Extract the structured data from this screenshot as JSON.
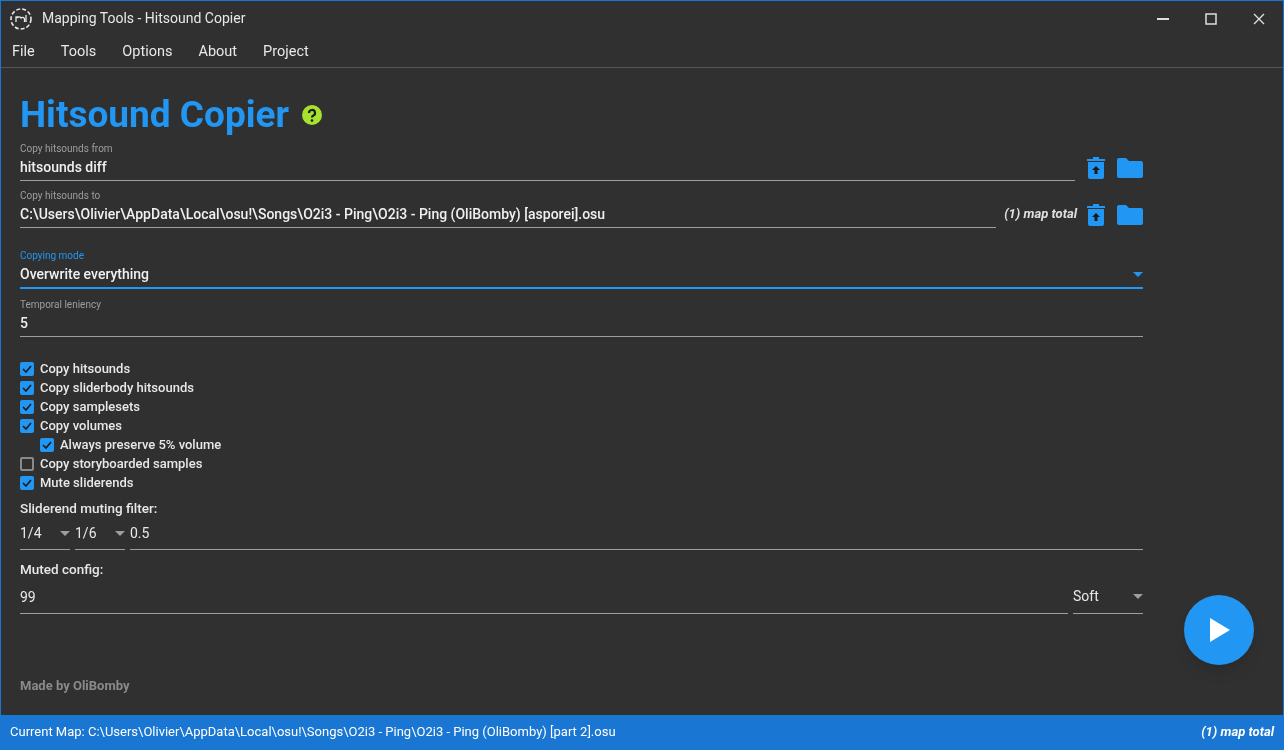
{
  "window": {
    "title": "Mapping Tools - Hitsound Copier"
  },
  "menu": [
    "File",
    "Tools",
    "Options",
    "About",
    "Project"
  ],
  "heading": "Hitsound Copier",
  "source": {
    "label": "Copy hitsounds from",
    "value": "hitsounds diff"
  },
  "target": {
    "label": "Copy hitsounds to",
    "value": "C:\\Users\\Olivier\\AppData\\Local\\osu!\\Songs\\O2i3 - Ping\\O2i3 - Ping (OliBomby) [asporei].osu",
    "note": "(1) map total"
  },
  "copying_mode": {
    "label": "Copying mode",
    "value": "Overwrite everything",
    "focused": true
  },
  "temporal_leniency": {
    "label": "Temporal leniency",
    "value": "5"
  },
  "options": [
    {
      "label": "Copy hitsounds",
      "checked": true
    },
    {
      "label": "Copy sliderbody hitsounds",
      "checked": true
    },
    {
      "label": "Copy samplesets",
      "checked": true
    },
    {
      "label": "Copy volumes",
      "checked": true,
      "children": [
        {
          "label": "Always preserve 5% volume",
          "checked": true
        }
      ]
    },
    {
      "label": "Copy storyboarded samples",
      "checked": false
    },
    {
      "label": "Mute sliderends",
      "checked": true
    }
  ],
  "sliderend_filter": {
    "label": "Sliderend muting filter:",
    "selects": [
      "1/4",
      "1/6"
    ],
    "value": "0.5"
  },
  "muted_config": {
    "label": "Muted config:",
    "value": "99",
    "select": "Soft"
  },
  "footer": "Made by OliBomby",
  "status_bar": {
    "current_map": "Current Map: C:\\Users\\Olivier\\AppData\\Local\\osu!\\Songs\\O2i3 - Ping\\O2i3 - Ping (OliBomby) [part 2].osu",
    "map_total": "(1) map total"
  }
}
